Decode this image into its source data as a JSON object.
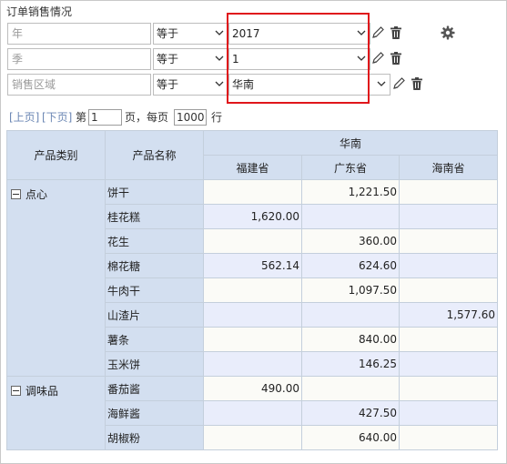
{
  "title": "订单销售情况",
  "filters": [
    {
      "field": "年",
      "operator": "等于",
      "value": "2017"
    },
    {
      "field": "季",
      "operator": "等于",
      "value": "1"
    },
    {
      "field": "销售区域",
      "operator": "等于",
      "value": "华南"
    }
  ],
  "icons": {
    "edit": "pencil-icon",
    "delete": "trash-icon",
    "settings": "gear-icon",
    "dropdown": "chevron-down-icon",
    "collapse": "minus-square-icon"
  },
  "colors": {
    "highlight": "#e0161b",
    "header_bg": "#d3dff0",
    "row_alt": "#e9edfb",
    "link": "#6b87b4"
  },
  "pager": {
    "prev": "[上页]",
    "next": "[下页]",
    "page_prefix": "第",
    "page_value": "1",
    "page_suffix": "页，每页",
    "per_page_value": "1000",
    "per_page_suffix": "行"
  },
  "table": {
    "headers": {
      "category": "产品类别",
      "product": "产品名称",
      "region": "华南"
    },
    "provinces": [
      "福建省",
      "广东省",
      "海南省"
    ],
    "groups": [
      {
        "category": "点心",
        "rows": [
          {
            "product": "饼干",
            "values": [
              "",
              "1,221.50",
              ""
            ]
          },
          {
            "product": "桂花糕",
            "values": [
              "1,620.00",
              "",
              ""
            ]
          },
          {
            "product": "花生",
            "values": [
              "",
              "360.00",
              ""
            ]
          },
          {
            "product": "棉花糖",
            "values": [
              "562.14",
              "624.60",
              ""
            ]
          },
          {
            "product": "牛肉干",
            "values": [
              "",
              "1,097.50",
              ""
            ]
          },
          {
            "product": "山渣片",
            "values": [
              "",
              "",
              "1,577.60"
            ]
          },
          {
            "product": "薯条",
            "values": [
              "",
              "840.00",
              ""
            ]
          },
          {
            "product": "玉米饼",
            "values": [
              "",
              "146.25",
              ""
            ]
          }
        ]
      },
      {
        "category": "调味品",
        "rows": [
          {
            "product": "番茄酱",
            "values": [
              "490.00",
              "",
              ""
            ]
          },
          {
            "product": "海鲜酱",
            "values": [
              "",
              "427.50",
              ""
            ]
          },
          {
            "product": "胡椒粉",
            "values": [
              "",
              "640.00",
              ""
            ]
          }
        ]
      }
    ]
  }
}
